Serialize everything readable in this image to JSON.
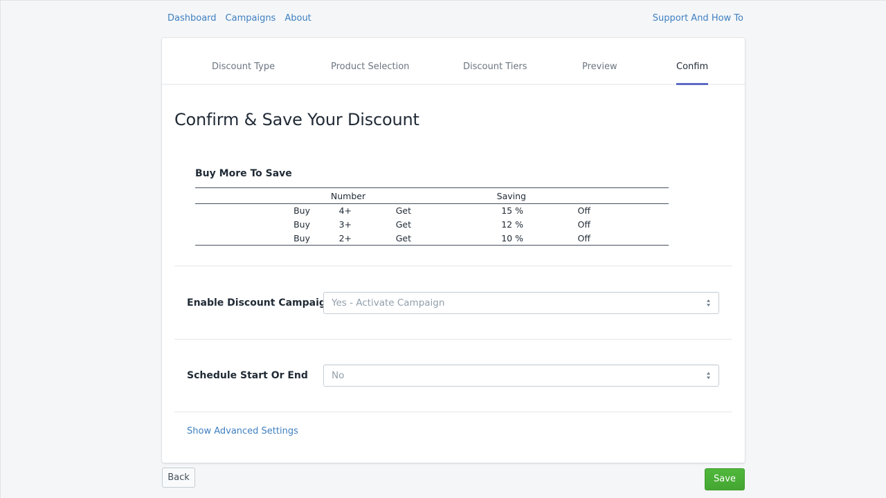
{
  "topnav": {
    "links": [
      {
        "label": "Dashboard"
      },
      {
        "label": "Campaigns"
      },
      {
        "label": "About"
      }
    ],
    "support_label": "Support And How To"
  },
  "steps": {
    "tabs": [
      {
        "label": "Discount Type",
        "active": false
      },
      {
        "label": "Product Selection",
        "active": false
      },
      {
        "label": "Discount Tiers",
        "active": false
      },
      {
        "label": "Preview",
        "active": false
      },
      {
        "label": "Confim",
        "active": true
      }
    ],
    "accent_color": "#5c6ac4"
  },
  "page": {
    "title": "Confirm & Save Your Discount"
  },
  "tiers": {
    "heading": "Buy More To Save",
    "columns": [
      "Number",
      "Saving"
    ],
    "rows": [
      {
        "buy": "Buy",
        "number": "4+",
        "get": "Get",
        "saving": "15 %",
        "off": "Off"
      },
      {
        "buy": "Buy",
        "number": "3+",
        "get": "Get",
        "saving": "12 %",
        "off": "Off"
      },
      {
        "buy": "Buy",
        "number": "2+",
        "get": "Get",
        "saving": "10 %",
        "off": "Off"
      }
    ]
  },
  "form": {
    "enable": {
      "label": "Enable Discount Campaign",
      "value": "Yes - Activate Campaign"
    },
    "schedule": {
      "label": "Schedule Start Or End",
      "value": "No"
    },
    "advanced_link": "Show Advanced Settings"
  },
  "footer": {
    "back_label": "Back",
    "save_label": "Save",
    "save_color": "#50b83c"
  }
}
